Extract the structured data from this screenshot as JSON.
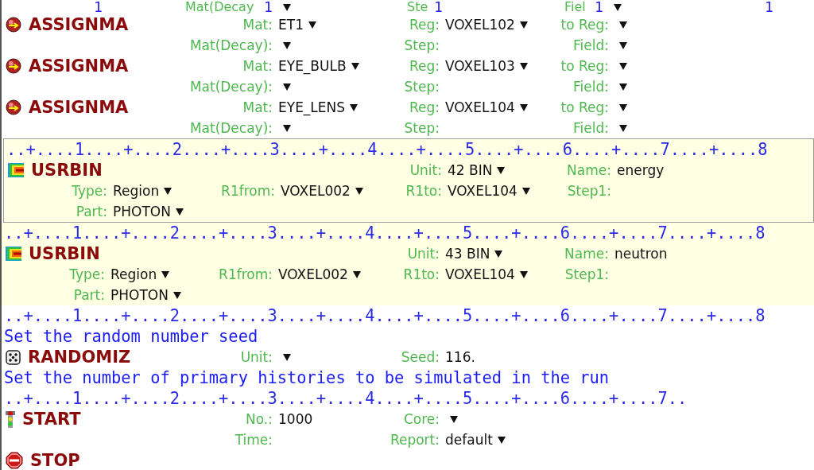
{
  "clipped_top": [
    {
      "kind": "digit",
      "text": "1"
    },
    {
      "kind": "label",
      "text": "Mat(Decay"
    },
    {
      "kind": "digit",
      "text": "1"
    },
    {
      "kind": "caret"
    },
    {
      "kind": "label",
      "text": "Ste"
    },
    {
      "kind": "digit",
      "text": "1"
    },
    {
      "kind": "label",
      "text": "Fiel"
    },
    {
      "kind": "digit",
      "text": "1"
    },
    {
      "kind": "caret"
    },
    {
      "kind": "digit",
      "text": "1"
    }
  ],
  "cards": [
    {
      "kind": "assignma",
      "name": "ASSIGNMA",
      "selected": false,
      "focused": false,
      "lines": [
        {
          "column_2": {
            "label": "Mat:",
            "kind": "dropdown",
            "value": "ET1"
          },
          "column_3": {
            "label": "Reg:",
            "kind": "dropdown",
            "value": "VOXEL102"
          },
          "column_4": {
            "label": "to Reg:",
            "kind": "dropdown"
          }
        },
        {
          "column_2": {
            "label": "Mat(Decay):",
            "kind": "dropdown"
          },
          "column_3": {
            "label": "Step:",
            "kind": "text"
          },
          "column_4": {
            "label": "Field:",
            "kind": "dropdown"
          }
        }
      ]
    },
    {
      "kind": "assignma",
      "name": "ASSIGNMA",
      "selected": false,
      "focused": false,
      "lines": [
        {
          "column_2": {
            "label": "Mat:",
            "kind": "dropdown",
            "value": "EYE_BULB"
          },
          "column_3": {
            "label": "Reg:",
            "kind": "dropdown",
            "value": "VOXEL103"
          },
          "column_4": {
            "label": "to Reg:",
            "kind": "dropdown"
          }
        },
        {
          "column_2": {
            "label": "Mat(Decay):",
            "kind": "dropdown"
          },
          "column_3": {
            "label": "Step:",
            "kind": "text"
          },
          "column_4": {
            "label": "Field:",
            "kind": "dropdown"
          }
        }
      ]
    },
    {
      "kind": "assignma",
      "name": "ASSIGNMA",
      "selected": false,
      "focused": false,
      "lines": [
        {
          "column_2": {
            "label": "Mat:",
            "kind": "dropdown",
            "value": "EYE_LENS"
          },
          "column_3": {
            "label": "Reg:",
            "kind": "dropdown",
            "value": "VOXEL104"
          },
          "column_4": {
            "label": "to Reg:",
            "kind": "dropdown"
          }
        },
        {
          "column_2": {
            "label": "Mat(Decay):",
            "kind": "dropdown"
          },
          "column_3": {
            "label": "Step:",
            "kind": "text"
          },
          "column_4": {
            "label": "Field:",
            "kind": "dropdown"
          }
        }
      ]
    },
    {
      "kind": "usrbin",
      "name": "USRBIN",
      "selected": true,
      "focused": true,
      "pre": [
        {
          "kind": "ruler",
          "text": "..+....1....+....2....+....3....+....4....+....5....+....6....+....7....+....8"
        }
      ],
      "lines": [
        {
          "column_3": {
            "label": "Unit:",
            "kind": "dropdown",
            "value": "42 BIN"
          },
          "column_4": {
            "label": "Name:",
            "kind": "text",
            "value": "energy"
          }
        },
        {
          "column_1": {
            "label": "Type:",
            "kind": "dropdown",
            "value": "Region"
          },
          "column_2": {
            "label": "R1from:",
            "kind": "dropdown",
            "value": "VOXEL002"
          },
          "column_3": {
            "label": "R1to:",
            "kind": "dropdown",
            "value": "VOXEL104"
          },
          "column_4": {
            "label": "Step1:",
            "kind": "text"
          }
        },
        {
          "column_1": {
            "label": "Part:",
            "kind": "dropdown",
            "value": "PHOTON"
          }
        }
      ]
    },
    {
      "kind": "usrbin",
      "name": "USRBIN",
      "selected": true,
      "focused": false,
      "pre": [
        {
          "kind": "ruler",
          "text": "..+....1....+....2....+....3....+....4....+....5....+....6....+....7....+....8"
        }
      ],
      "lines": [
        {
          "column_3": {
            "label": "Unit:",
            "kind": "dropdown",
            "value": "43 BIN"
          },
          "column_4": {
            "label": "Name:",
            "kind": "text",
            "value": "neutron"
          }
        },
        {
          "column_1": {
            "label": "Type:",
            "kind": "dropdown",
            "value": "Region"
          },
          "column_2": {
            "label": "R1from:",
            "kind": "dropdown",
            "value": "VOXEL002"
          },
          "column_3": {
            "label": "R1to:",
            "kind": "dropdown",
            "value": "VOXEL104"
          },
          "column_4": {
            "label": "Step1:",
            "kind": "text"
          }
        },
        {
          "column_1": {
            "label": "Part:",
            "kind": "dropdown",
            "value": "PHOTON"
          }
        }
      ]
    },
    {
      "kind": "randomiz",
      "name": "RANDOMIZ",
      "selected": false,
      "focused": false,
      "pre": [
        {
          "kind": "ruler",
          "text": "..+....1....+....2....+....3....+....4....+....5....+....6....+....7....+....8"
        },
        {
          "kind": "comment",
          "text": "Set the random number seed"
        }
      ],
      "lines": [
        {
          "column_2": {
            "label": "Unit:",
            "kind": "dropdown"
          },
          "column_3": {
            "label": "Seed:",
            "kind": "text",
            "value": "116."
          }
        }
      ]
    },
    {
      "kind": "start",
      "name": "START",
      "selected": false,
      "focused": false,
      "pre": [
        {
          "kind": "comment",
          "text": "Set the number of primary histories to be simulated in the run"
        },
        {
          "kind": "ruler",
          "text": "..+....1....+....2....+....3....+....4....+....5....+....6....+....7.."
        }
      ],
      "lines": [
        {
          "column_2": {
            "label": "No.:",
            "kind": "text",
            "value": "1000"
          },
          "column_3": {
            "label": "Core:",
            "kind": "dropdown"
          }
        },
        {
          "column_2": {
            "label": "Time:",
            "kind": "text"
          },
          "column_3": {
            "label": "Report:",
            "kind": "dropdown",
            "value": "default"
          }
        }
      ]
    },
    {
      "kind": "stop",
      "name": "STOP",
      "selected": false,
      "focused": false
    }
  ]
}
